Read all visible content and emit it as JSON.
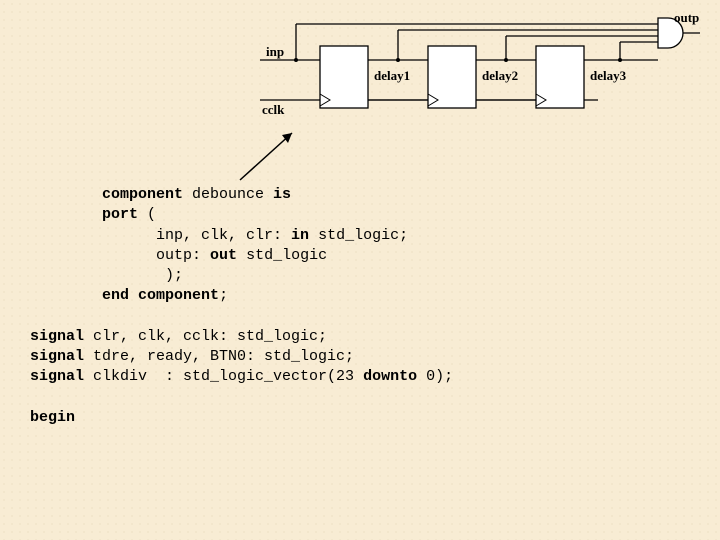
{
  "diagram": {
    "inp": "inp",
    "cclk": "cclk",
    "delay1": "delay1",
    "delay2": "delay2",
    "delay3": "delay3",
    "outp": "outp"
  },
  "code": {
    "l1a": "component",
    "l1b": " debounce ",
    "l1c": "is",
    "l2a": "port",
    "l2b": " (",
    "l3a": "      inp, clk, clr: ",
    "l3b": "in",
    "l3c": " std_logic;",
    "l4a": "      outp: ",
    "l4b": "out",
    "l4c": " std_logic",
    "l5": "       );",
    "l6a": "end",
    "l6b": " ",
    "l6c": "component",
    "l6d": ";",
    "s1a": "signal",
    "s1b": " clr, clk, cclk: std_logic;",
    "s2a": "signal",
    "s2b": " tdre, ready, BTN0: std_logic;",
    "s3a": "signal",
    "s3b": " clkdiv  : std_logic_vector(23 ",
    "s3c": "downto",
    "s3d": " 0);",
    "begin": "begin"
  }
}
